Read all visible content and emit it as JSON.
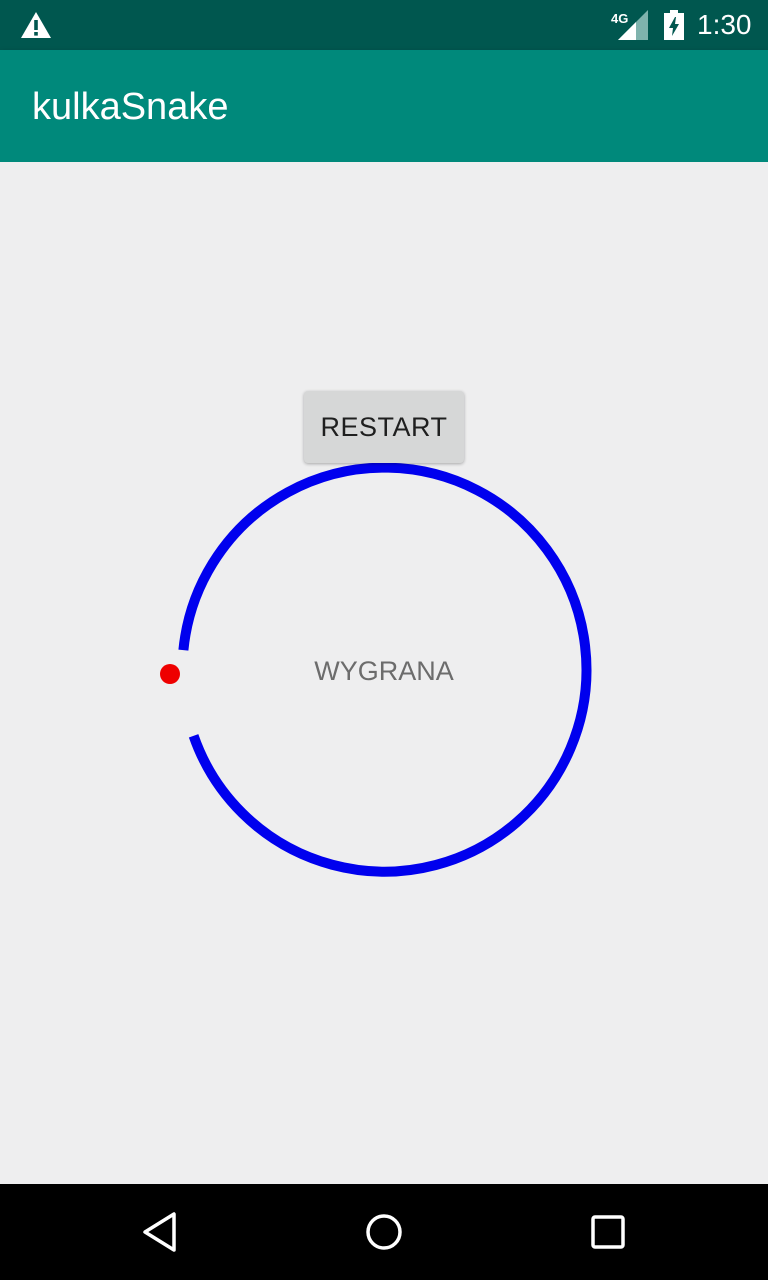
{
  "status_bar": {
    "network": "4G",
    "time": "1:30",
    "icons": [
      "warning-icon",
      "signal-icon",
      "battery-icon"
    ]
  },
  "app_bar": {
    "title": "kulkaSnake"
  },
  "game": {
    "restart_label": "RESTART",
    "status_text": "WYGRANA",
    "colors": {
      "snake": "#0000ee",
      "ball": "#ee0000"
    }
  },
  "nav_bar": {
    "icons": [
      "back-icon",
      "home-icon",
      "recents-icon"
    ]
  }
}
